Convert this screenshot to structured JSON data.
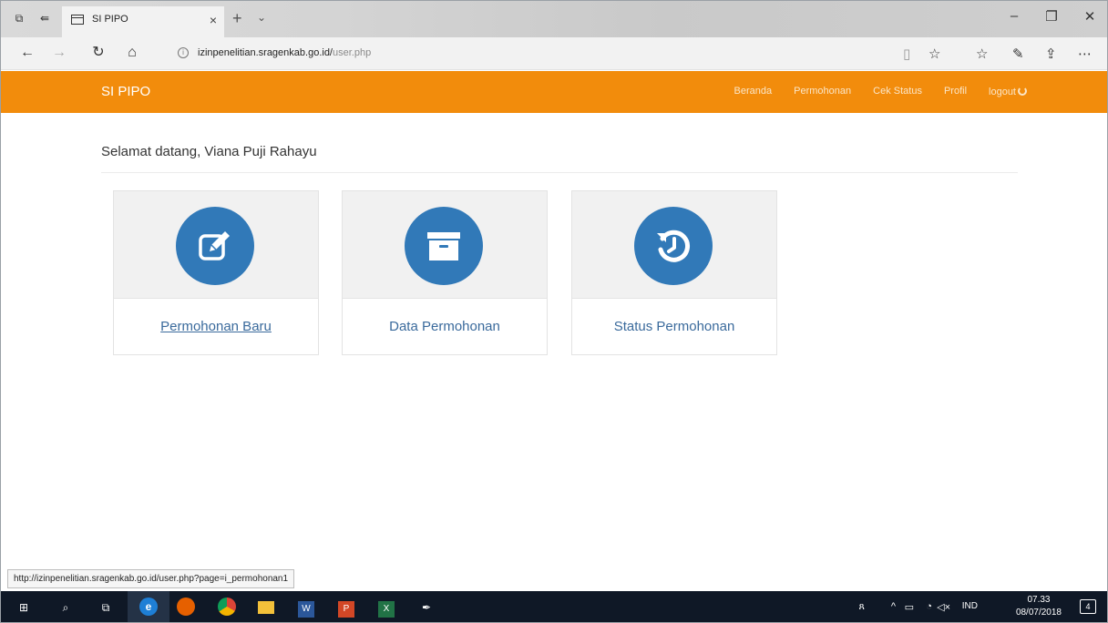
{
  "browser": {
    "tab_title": "SI PIPO",
    "tab_close": "×",
    "new_tab": "+",
    "tab_menu": "⌄",
    "url_domain": "izinpenelitian.sragenkab.go.id/",
    "url_path": "user.php",
    "status_url": "http://izinpenelitian.sragenkab.go.id/user.php?page=i_permohonan1"
  },
  "site": {
    "brand": "SI PIPO",
    "nav": [
      "Beranda",
      "Permohonan",
      "Cek Status",
      "Profil",
      "logout"
    ],
    "welcome": "Selamat datang, Viana Puji Rahayu",
    "accent_color": "#f28c0c",
    "icon_color": "#3179b8",
    "cards": [
      {
        "label": "Permohonan Baru",
        "icon": "edit-icon"
      },
      {
        "label": "Data Permohonan",
        "icon": "archive-icon"
      },
      {
        "label": "Status Permohonan",
        "icon": "history-icon"
      }
    ]
  },
  "taskbar": {
    "language": "IND",
    "time": "07.33",
    "date": "08/07/2018",
    "notifications": "4"
  }
}
